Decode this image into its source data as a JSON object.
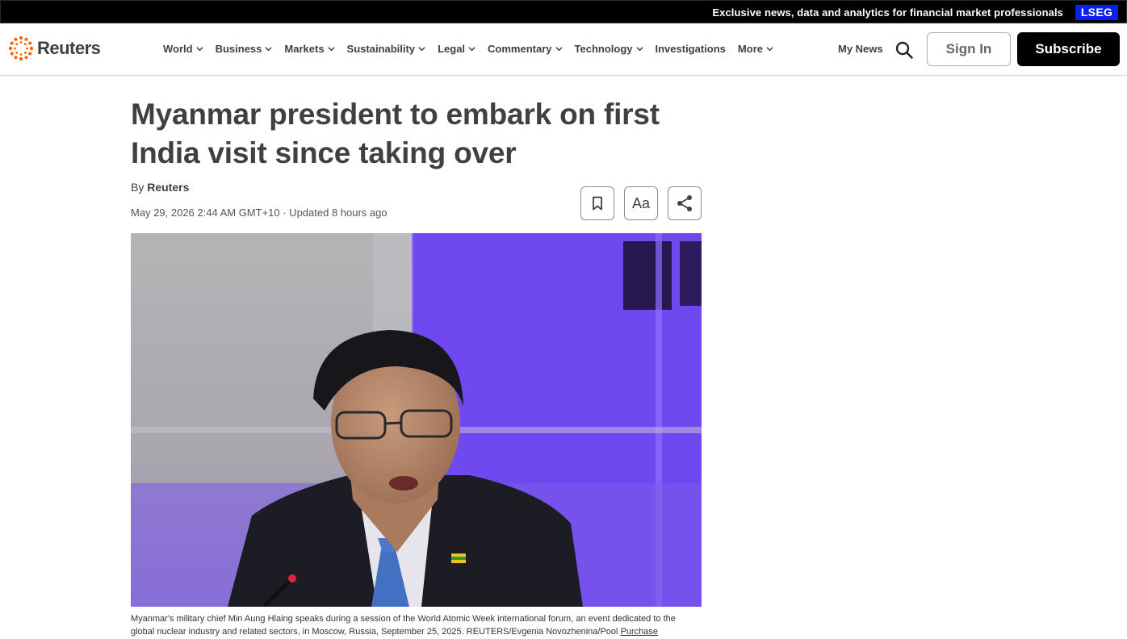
{
  "banner": {
    "text": "Exclusive news, data and analytics for financial market professionals",
    "badge": "LSEG"
  },
  "header": {
    "logo_text": "Reuters",
    "nav": [
      {
        "label": "World",
        "has_dropdown": true
      },
      {
        "label": "Business",
        "has_dropdown": true
      },
      {
        "label": "Markets",
        "has_dropdown": true
      },
      {
        "label": "Sustainability",
        "has_dropdown": true
      },
      {
        "label": "Legal",
        "has_dropdown": true
      },
      {
        "label": "Commentary",
        "has_dropdown": true
      },
      {
        "label": "Technology",
        "has_dropdown": true
      },
      {
        "label": "Investigations",
        "has_dropdown": false
      },
      {
        "label": "More",
        "has_dropdown": true
      }
    ],
    "my_news": "My News",
    "sign_in": "Sign In",
    "subscribe": "Subscribe"
  },
  "article": {
    "headline": "Myanmar president to embark on first India visit since taking over",
    "byline_prefix": "By",
    "byline_author": "Reuters",
    "dateline": "May 29, 2026 2:44 AM GMT+10 · Updated 8 hours ago",
    "font_button_label": "Aa",
    "caption": "Myanmar's military chief Min Aung Hlaing speaks during a session of the World Atomic Week international forum, an event dedicated to the global nuclear industry and related sectors, in Moscow, Russia, September 25, 2025. REUTERS/Evgenia Novozhenina/Pool",
    "caption_link": "Purchase"
  },
  "colors": {
    "banner_bg": "#000000",
    "lseg_blue": "#0a1ff5",
    "logo_orange": "#fa6400",
    "text": "#404040"
  }
}
